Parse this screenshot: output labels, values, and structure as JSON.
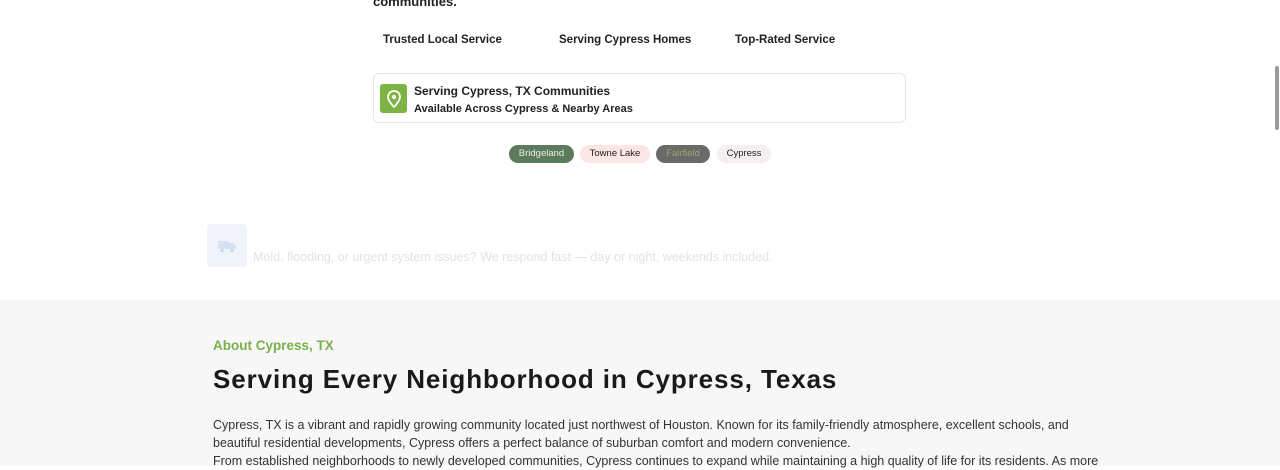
{
  "intro": {
    "cut_text": "communities."
  },
  "features": [
    {
      "label": "Trusted Local Service"
    },
    {
      "label": "Serving Cypress Homes"
    },
    {
      "label": "Top-Rated Service"
    }
  ],
  "serve_card": {
    "icon": "map-pin-icon",
    "title": "Serving Cypress, TX Communities",
    "subtitle": "Available Across Cypress & Nearby Areas"
  },
  "chips": [
    {
      "label": "Bridgeland"
    },
    {
      "label": "Towne Lake"
    },
    {
      "label": "Fairfield"
    },
    {
      "label": "Cypress"
    }
  ],
  "emergency": {
    "icon": "emergency-truck-icon",
    "text": "Mold, flooding, or urgent system issues? We respond fast — day or night, weekends included."
  },
  "about": {
    "label": "About Cypress, TX",
    "heading": "Serving Every Neighborhood in Cypress, Texas",
    "paragraph_lines": [
      "Cypress, TX is a vibrant and rapidly growing community located just northwest of Houston. Known for its family-friendly atmosphere, excellent schools, and",
      "beautiful residential developments, Cypress offers a perfect balance of suburban comfort and modern convenience.",
      "From established neighborhoods to newly developed communities, Cypress continues to expand while maintaining a high quality of life for its residents. As more"
    ]
  },
  "colors": {
    "accent_green": "#7cb342",
    "about_label": "#7ab04a",
    "section_bg": "#f7f7f7"
  }
}
